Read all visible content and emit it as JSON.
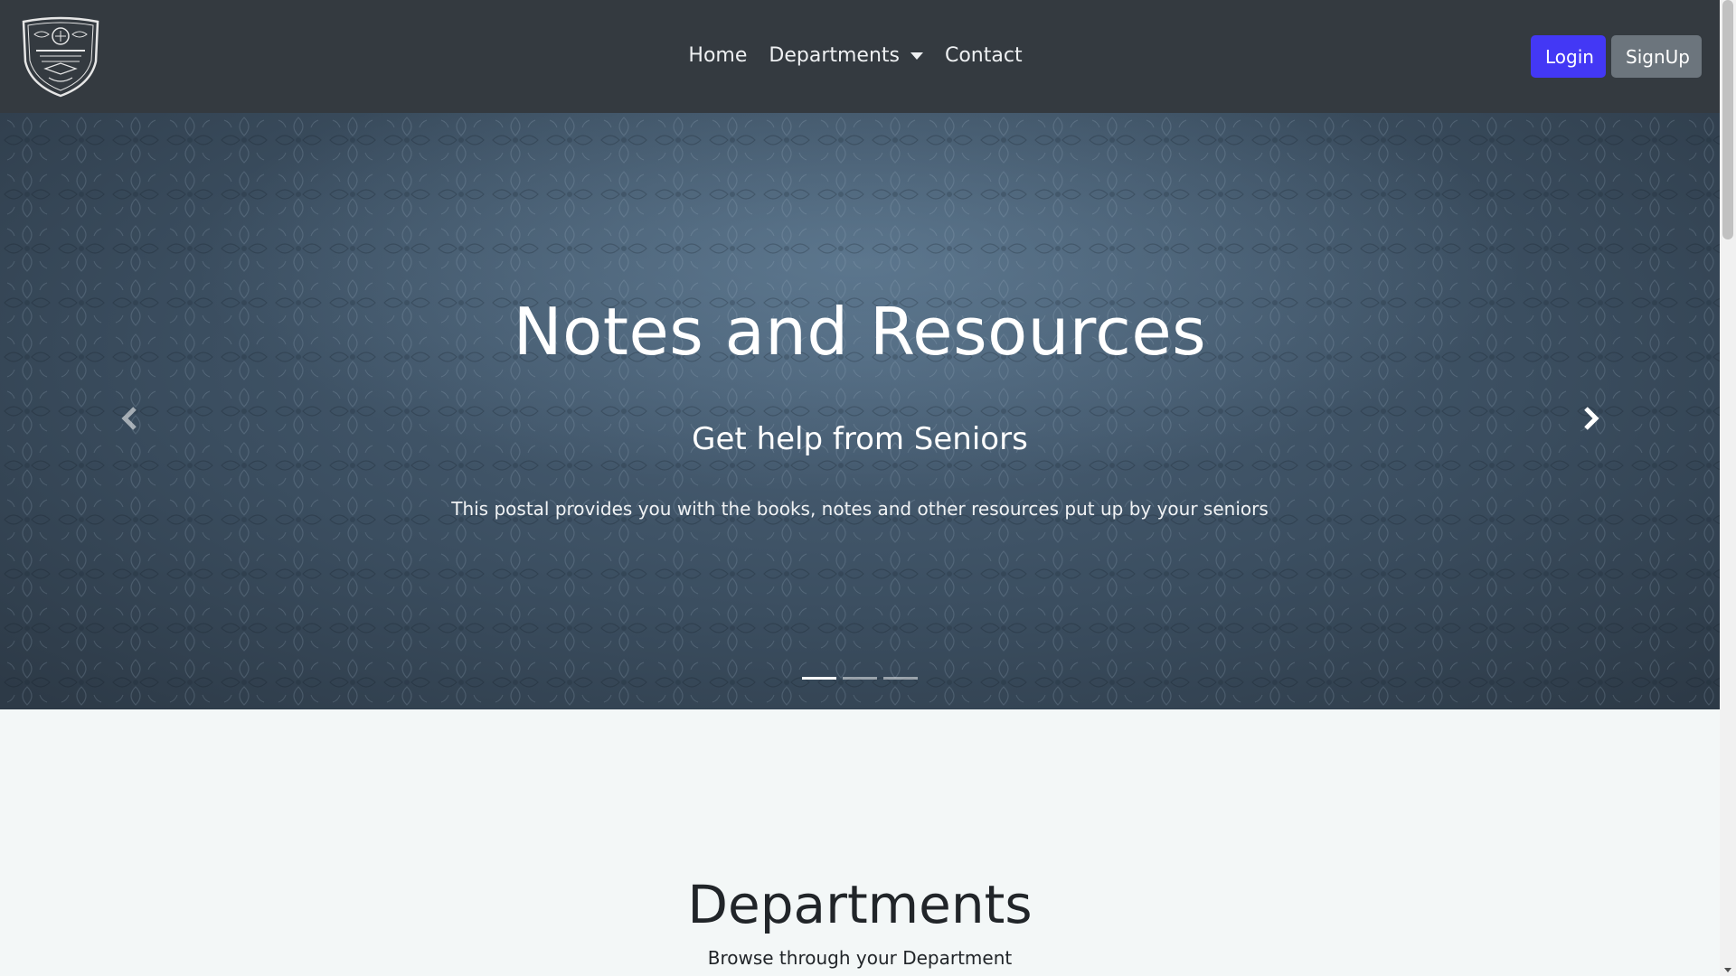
{
  "navbar": {
    "links": [
      {
        "label": "Home"
      },
      {
        "label": "Departments"
      },
      {
        "label": "Contact"
      }
    ],
    "login_label": "Login",
    "signup_label": "SignUp"
  },
  "hero": {
    "title": "Notes and Resources",
    "subtitle": "Get help from Seniors",
    "description": "This postal provides you with the books, notes and other resources put up by your seniors",
    "slide_count": 3,
    "active_slide": 1
  },
  "departments": {
    "title": "Departments",
    "subtitle": "Browse through your Department"
  },
  "colors": {
    "navbar_bg": "#343a40",
    "login_button": "#4338f5",
    "signup_button": "#6c757d",
    "page_bg": "#f3f7f7"
  },
  "icons": {
    "logo": "college-crest-icon",
    "dropdown": "caret-down-icon",
    "prev": "chevron-left-icon",
    "next": "chevron-right-icon"
  }
}
